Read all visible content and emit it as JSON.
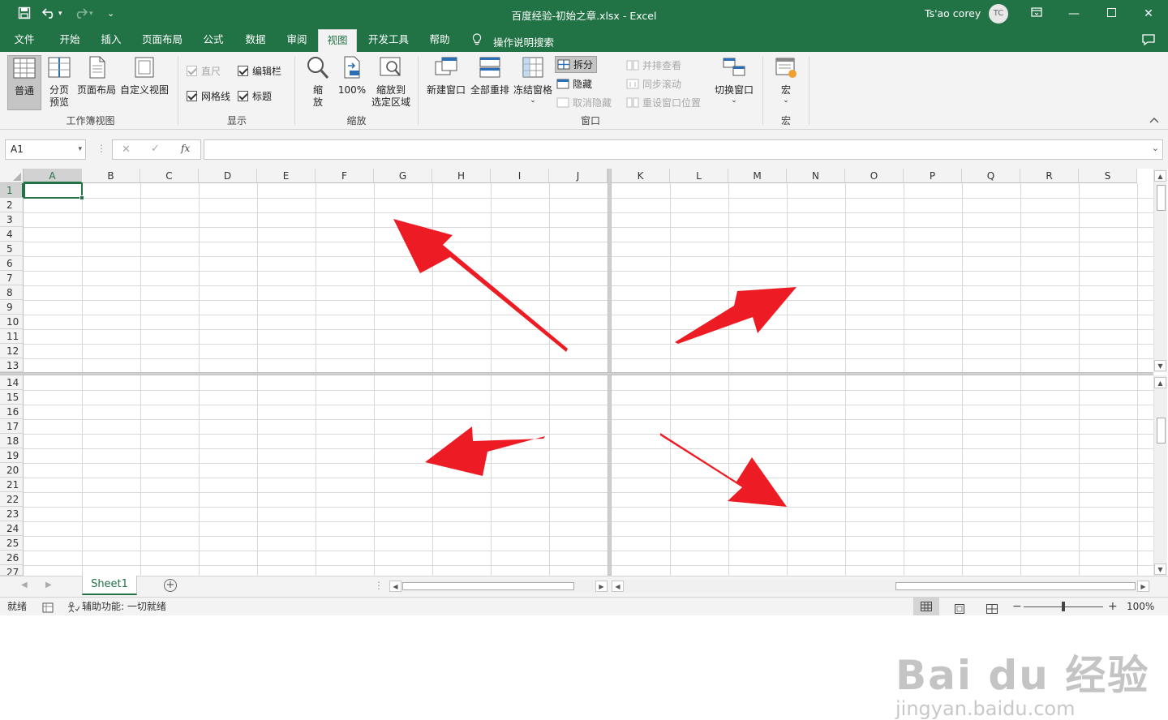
{
  "titlebar": {
    "filename": "百度经验-初始之章.xlsx",
    "separator": "-",
    "app": "Excel",
    "user_name": "Ts'ao corey",
    "user_initials": "TC"
  },
  "tabs": [
    "文件",
    "开始",
    "插入",
    "页面布局",
    "公式",
    "数据",
    "审阅",
    "视图",
    "开发工具",
    "帮助"
  ],
  "active_tab": "视图",
  "tell_me": "操作说明搜索",
  "ribbon": {
    "workbook_views": {
      "label": "工作簿视图",
      "normal": "普通",
      "page_break_1": "分页",
      "page_break_2": "预览",
      "page_layout": "页面布局",
      "custom_views": "自定义视图"
    },
    "show": {
      "label": "显示",
      "ruler": "直尺",
      "formula_bar": "编辑栏",
      "gridlines": "网格线",
      "headings": "标题"
    },
    "zoom": {
      "label": "缩放",
      "zoom_1": "缩",
      "zoom_2": "放",
      "hundred": "100%",
      "zoom_sel_1": "缩放到",
      "zoom_sel_2": "选定区域"
    },
    "window": {
      "label": "窗口",
      "new_window": "新建窗口",
      "arrange_all": "全部重排",
      "freeze_panes": "冻结窗格",
      "split": "拆分",
      "hide": "隐藏",
      "unhide": "取消隐藏",
      "side_by_side": "并排查看",
      "sync_scroll": "同步滚动",
      "reset_position": "重设窗口位置",
      "switch_windows": "切换窗口"
    },
    "macros": {
      "label": "宏",
      "macros": "宏"
    }
  },
  "formula_bar": {
    "name_box": "A1",
    "fx": "fx",
    "value": ""
  },
  "columns_left": [
    "A",
    "B",
    "C",
    "D",
    "E",
    "F",
    "G",
    "H",
    "I",
    "J"
  ],
  "columns_right": [
    "K",
    "L",
    "M",
    "N",
    "O",
    "P",
    "Q",
    "R",
    "S"
  ],
  "rows_top": [
    "1",
    "2",
    "3",
    "4",
    "5",
    "6",
    "7",
    "8",
    "9",
    "10",
    "11",
    "12",
    "13"
  ],
  "rows_bottom": [
    "14",
    "15",
    "16",
    "17",
    "18",
    "19",
    "20",
    "21",
    "22",
    "23",
    "24",
    "25",
    "26",
    "27"
  ],
  "selected_cell": "A1",
  "sheet": {
    "name": "Sheet1"
  },
  "status": {
    "ready": "就绪",
    "accessibility": "辅助功能: 一切就绪",
    "zoom": "100%"
  },
  "colors": {
    "excel_green": "#217346",
    "arrow_red": "#ed1c24"
  },
  "watermark": {
    "brand": "Bai du 经验",
    "url": "jingyan.baidu.com"
  }
}
